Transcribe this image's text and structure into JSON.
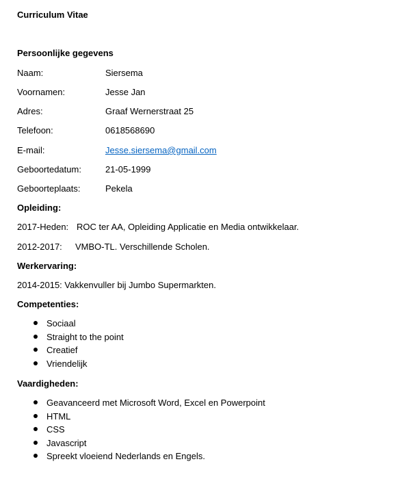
{
  "doc": {
    "title": "Curriculum Vitae"
  },
  "personal": {
    "heading": "Persoonlijke gegevens",
    "rows": [
      {
        "label": "Naam:",
        "value": "Siersema"
      },
      {
        "label": "Voornamen:",
        "value": "Jesse Jan"
      },
      {
        "label": "Adres:",
        "value": "Graaf Wernerstraat 25"
      },
      {
        "label": "Telefoon:",
        "value": "0618568690"
      },
      {
        "label": "E-mail:",
        "value": "Jesse.siersema@gmail.com"
      },
      {
        "label": "Geboortedatum:",
        "value": "21-05-1999"
      },
      {
        "label": "Geboorteplaats:",
        "value": "Pekela"
      }
    ]
  },
  "education": {
    "heading": "Opleiding:",
    "items": [
      {
        "period": "2017-Heden:",
        "text": "ROC ter AA, Opleiding Applicatie en Media ontwikkelaar."
      },
      {
        "period": "2012-2017:",
        "text": "VMBO-TL. Verschillende Scholen."
      }
    ]
  },
  "work": {
    "heading": "Werkervaring:",
    "items": [
      {
        "text": "2014-2015: Vakkenvuller bij Jumbo Supermarkten."
      }
    ]
  },
  "competencies": {
    "heading": "Competenties:",
    "items": [
      "Sociaal",
      "Straight to the point",
      "Creatief",
      "Vriendelijk"
    ]
  },
  "skills": {
    "heading": "Vaardigheden:",
    "items": [
      "Geavanceerd met Microsoft Word, Excel en Powerpoint",
      "HTML",
      "CSS",
      "Javascript",
      "Spreekt vloeiend Nederlands en Engels."
    ]
  },
  "colors": {
    "link": "#0563C1",
    "text": "#000000",
    "background": "#FFFFFF"
  }
}
